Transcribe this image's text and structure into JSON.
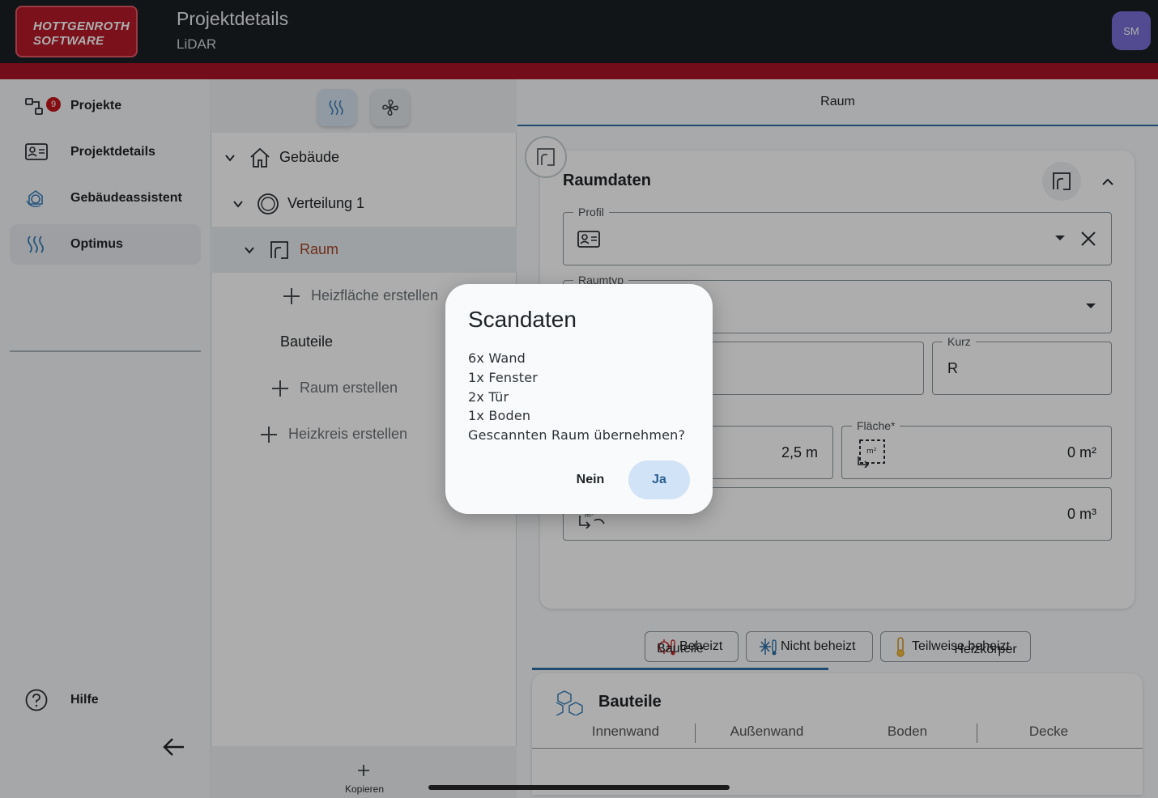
{
  "header": {
    "logo_line1": "HOTTGENROTH",
    "logo_line2": "SOFTWARE",
    "title": "Projektdetails",
    "subtitle": "LiDAR",
    "avatar_initials": "SM"
  },
  "sidebar": {
    "items": [
      {
        "label": "Projekte",
        "icon": "projects-network-icon",
        "badge": "9"
      },
      {
        "label": "Projektdetails",
        "icon": "id-card-icon"
      },
      {
        "label": "Gebäudeassistent",
        "icon": "building-assistant-icon"
      },
      {
        "label": "Optimus",
        "icon": "heat-waves-icon",
        "active": true
      }
    ],
    "help_label": "Hilfe"
  },
  "tree": {
    "toolbar": [
      "heat-waves-icon",
      "fan-icon"
    ],
    "rows": [
      {
        "label": "Gebäude",
        "icon": "home-icon"
      },
      {
        "label": "Verteilung 1",
        "icon": "circle-icon"
      },
      {
        "label": "Raum",
        "icon": "room-icon"
      },
      {
        "label": "Heizfläche erstellen",
        "icon": "plus-icon"
      },
      {
        "label": "Bauteile"
      },
      {
        "label": "Raum erstellen",
        "icon": "plus-icon"
      },
      {
        "label": "Heizkreis erstellen",
        "icon": "plus-icon"
      }
    ],
    "footer_label": "Kopieren"
  },
  "right": {
    "tab_label": "Raum",
    "card_title": "Raumdaten",
    "profil_label": "Profil",
    "raumtyp_label": "Raumtyp",
    "kurz_label": "Kurz",
    "kurz_value": "R",
    "hoehe_value": "2,5 m",
    "flaeche_label": "Fläche*",
    "flaeche_value": "0 m²",
    "volumen_value": "0 m³",
    "chips": [
      "Beheizt",
      "Nicht beheizt",
      "Teilweise beheizt"
    ],
    "subtabs": [
      "Bauteile",
      "Heizkörper"
    ],
    "card2_title": "Bauteile",
    "card2_tabs": [
      "Innenwand",
      "Außenwand",
      "Boden",
      "Decke"
    ]
  },
  "dialog": {
    "title": "Scandaten",
    "lines": [
      "6x Wand",
      "1x Fenster",
      "2x Tür",
      "1x Boden",
      "Gescannten Raum übernehmen?"
    ],
    "no_label": "Nein",
    "yes_label": "Ja"
  },
  "colors": {
    "brand_red": "#a81425",
    "accent_blue": "#2f6fa7",
    "tree_accent": "#a4462a",
    "avatar": "#7b6fd6"
  }
}
